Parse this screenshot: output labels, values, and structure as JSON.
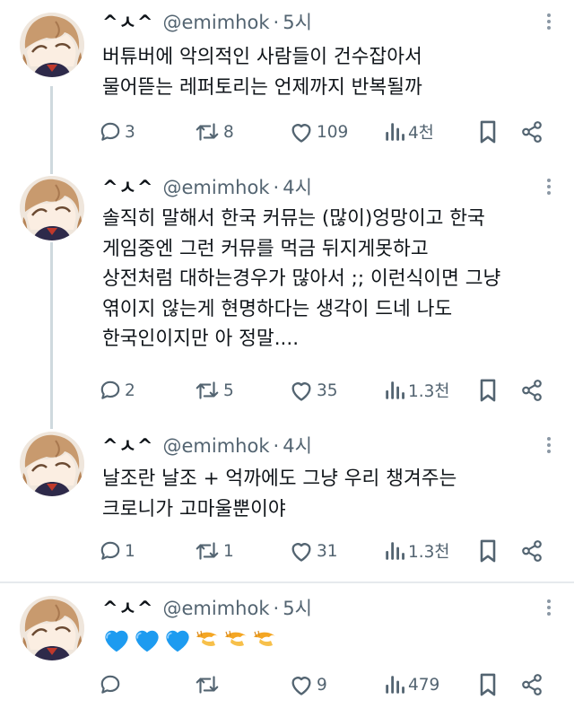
{
  "author": {
    "display_name": "^ㅅ^",
    "handle": "@emimhok"
  },
  "tweets": [
    {
      "time": "5시",
      "lines": [
        "버튜버에 악의적인 사람들이 건수잡아서",
        "물어뜯는 레퍼토리는 언제까지 반복될까"
      ],
      "replies": "3",
      "retweets": "8",
      "likes": "109",
      "views": "4천"
    },
    {
      "time": "4시",
      "lines": [
        "솔직히 말해서 한국 커뮤는 (많이)엉망이고 한국",
        "게임중엔 그런 커뮤를 먹금 뒤지게못하고",
        "상전처럼 대하는경우가 많아서 ;; 이런식이면 그냥",
        "엮이지 않는게 현명하다는 생각이 드네 나도",
        "한국인이지만 아 정말...."
      ],
      "replies": "2",
      "retweets": "5",
      "likes": "35",
      "views": "1.3천"
    },
    {
      "time": "4시",
      "lines": [
        "날조란 날조 + 억까에도 그냥 우리 챙겨주는",
        "크로니가 고마울뿐이야"
      ],
      "replies": "1",
      "retweets": "1",
      "likes": "31",
      "views": "1.3천"
    },
    {
      "time": "5시",
      "emojis": [
        "blue-heart",
        "blue-heart",
        "blue-heart",
        "shrimp",
        "shrimp",
        "shrimp"
      ],
      "replies": "",
      "retweets": "",
      "likes": "9",
      "views": "479"
    }
  ],
  "separator": "·",
  "colors": {
    "text": "#0f1419",
    "muted": "#536471",
    "thread_line": "#cfd9de",
    "blue_heart": "#1d9bf0",
    "shrimp": "#f4a623"
  }
}
